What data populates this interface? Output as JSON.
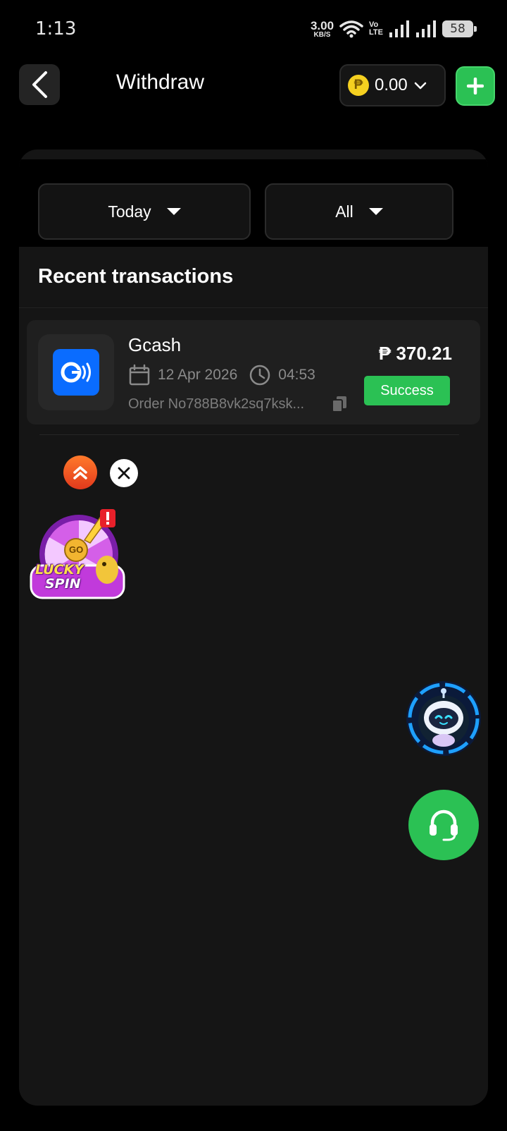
{
  "status_bar": {
    "time": "1:13",
    "net_speed": "3.00",
    "net_unit": "KB/S",
    "volte_top": "Vo",
    "volte_bottom": "LTE",
    "battery": "58"
  },
  "header": {
    "title": "Withdraw",
    "currency_symbol": "₱",
    "balance": "0.00"
  },
  "filters": {
    "date": "Today",
    "type": "All"
  },
  "section_title": "Recent transactions",
  "transactions": [
    {
      "method": "Gcash",
      "date": "12 Apr 2026",
      "time": "04:53",
      "order": "Order No788B8vk2sq7ksk...",
      "amount": "₱ 370.21",
      "status": "Success"
    }
  ],
  "promo": {
    "badge_label": "GO",
    "line1": "LUCKY",
    "line2": "SPIN"
  },
  "colors": {
    "accent_green": "#2bc154",
    "gcash_blue": "#0a6cff",
    "coin_yellow": "#f5d020"
  },
  "icons": [
    "back-arrow-icon",
    "chevron-down-icon",
    "plus-icon",
    "calendar-icon",
    "clock-icon",
    "copy-icon",
    "double-chevron-up-icon",
    "close-icon",
    "headset-icon",
    "robot-icon"
  ]
}
